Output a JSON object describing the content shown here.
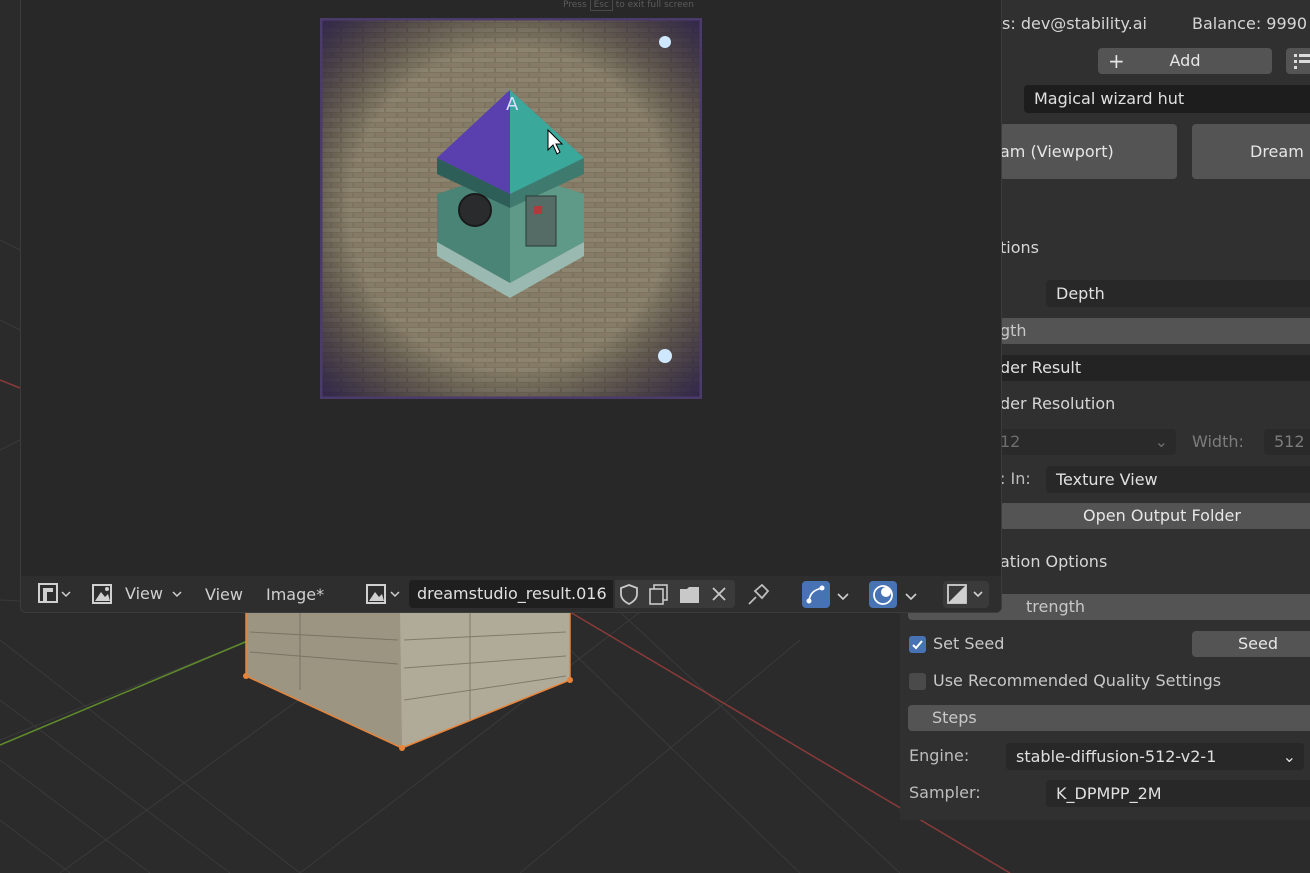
{
  "fullscreen_hint": {
    "press": "Press",
    "key": "Esc",
    "text": "to exit full screen"
  },
  "account": {
    "user_text": "s: dev@stability.ai",
    "balance_text": "Balance: 9990"
  },
  "actions": {
    "add_label": "Add",
    "prompt_value": "Magical wizard hut",
    "dream_viewport_label": "am (Viewport)",
    "dream_label": "Dream ("
  },
  "options": {
    "section_title": "tions",
    "controlnet_model": "Depth",
    "strength_label": "gth",
    "render_result_label": "der Result",
    "render_resolution_label": "der Resolution",
    "height_value": "12",
    "width_label": "Width:",
    "width_value": "512",
    "open_in_label": ": In:",
    "open_in_value": "Texture View",
    "open_output_folder_label": "Open Output Folder"
  },
  "generation": {
    "section_title": "ation Options",
    "strength_label": "trength",
    "set_seed_label": "Set Seed",
    "set_seed_checked": true,
    "seed_label": "Seed",
    "recommended_label": "Use Recommended Quality Settings",
    "recommended_checked": false,
    "steps_label": "Steps",
    "engine_label": "Engine:",
    "engine_value": "stable-diffusion-512-v2-1",
    "sampler_label": "Sampler:",
    "sampler_value": "K_DPMPP_2M"
  },
  "image_editor": {
    "menu_view_label": "View",
    "menu_view2_label": "View",
    "menu_image_label": "Image*",
    "image_name": "dreamstudio_result.016"
  },
  "colors": {
    "accent": "#4772b3",
    "selection_orange": "#e8843a",
    "x_axis": "#b5413f",
    "y_axis": "#6a9a2e"
  },
  "icons": [
    "editor-type-icon",
    "view-image-icon",
    "image-browse-icon",
    "shield-icon",
    "duplicate-icon",
    "folder-icon",
    "close-icon",
    "pin-icon",
    "uv-sync-icon",
    "overlay-icon",
    "display-channels-icon",
    "checkbox-icon",
    "dropdown-chevron-icon",
    "plus-icon",
    "list-icon",
    "mouse-cursor-icon"
  ]
}
